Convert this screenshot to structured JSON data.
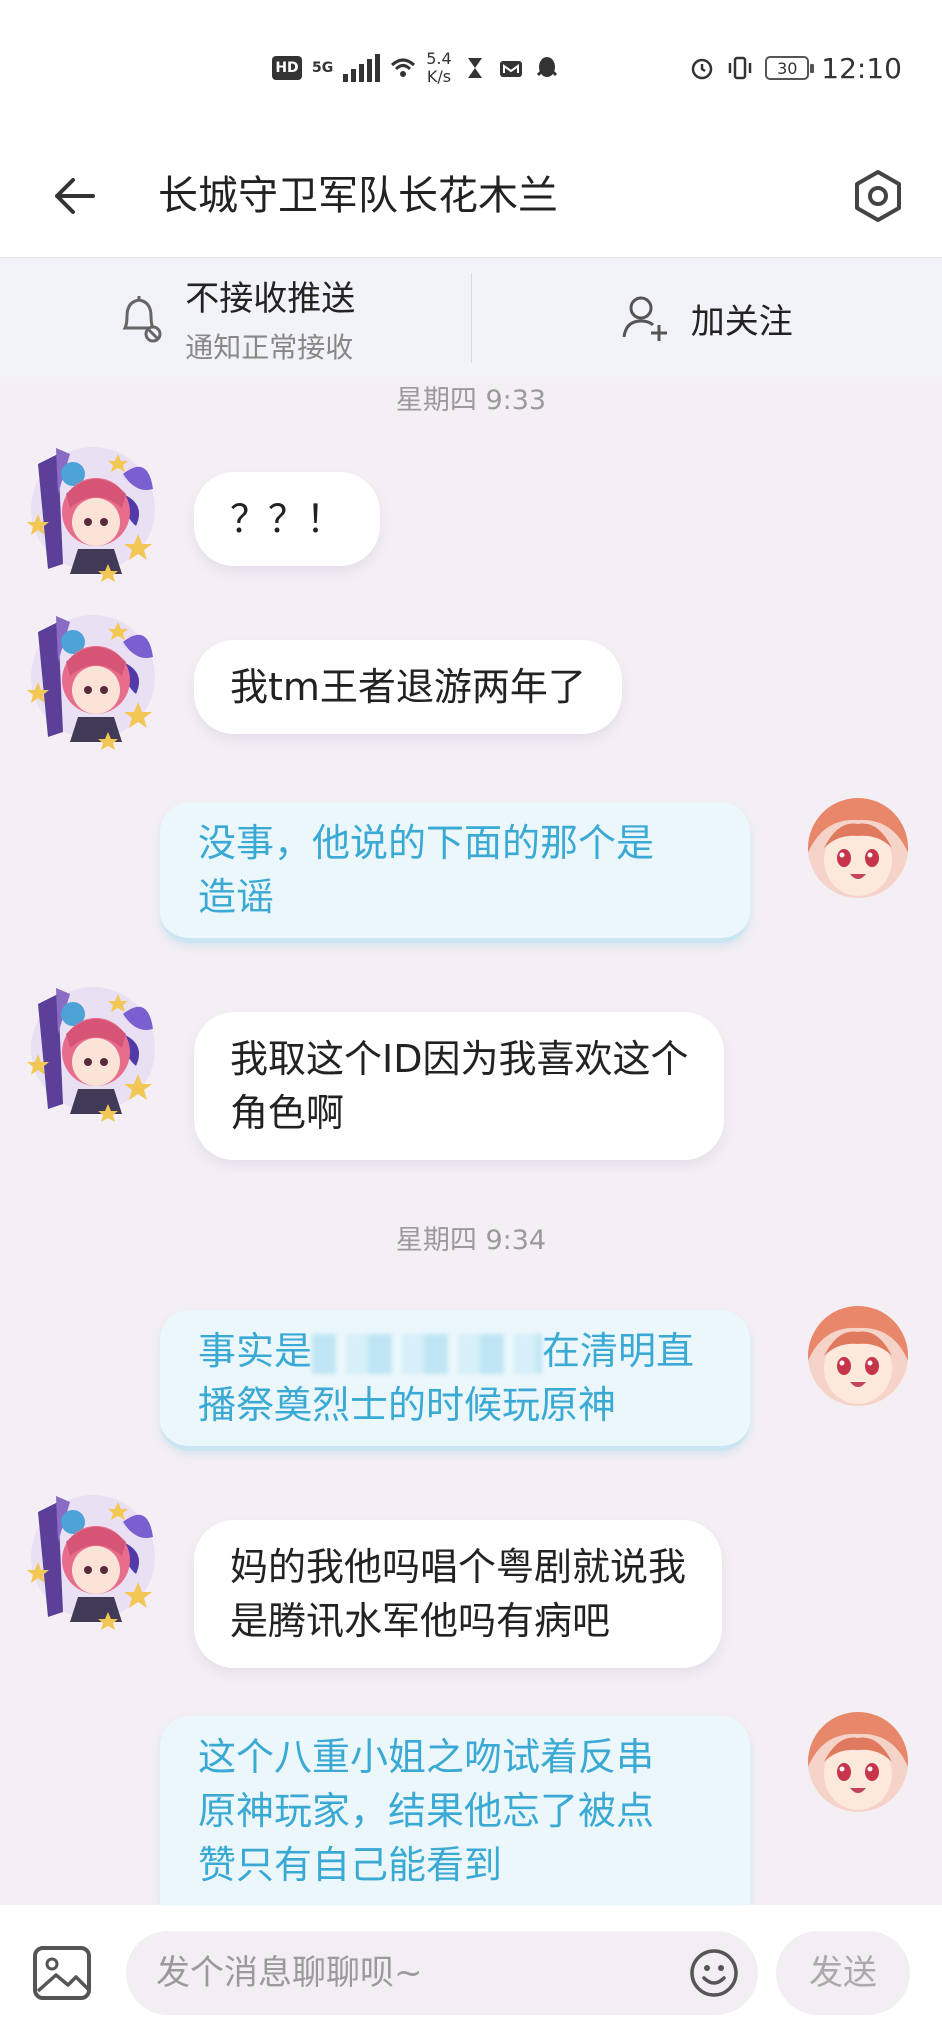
{
  "status_bar": {
    "hd": "HD",
    "network": "5G",
    "speed_value": "5.4",
    "speed_unit": "K/s",
    "battery": "30",
    "time": "12:10"
  },
  "header": {
    "title": "长城守卫军队长花木兰"
  },
  "actions": {
    "push_main": "不接收推送",
    "push_sub": "通知正常接收",
    "follow": "加关注"
  },
  "chat": {
    "timestamps": [
      "星期四 9:33",
      "星期四 9:34"
    ],
    "messages": [
      {
        "side": "in",
        "lines": [
          "？？！"
        ]
      },
      {
        "side": "in",
        "lines": [
          "我tm王者退游两年了"
        ]
      },
      {
        "side": "out",
        "lines": [
          "没事，他说的下面的那个是",
          "造谣"
        ]
      },
      {
        "side": "in",
        "lines": [
          "我取这个ID因为我喜欢这个",
          "角色啊"
        ]
      },
      {
        "side": "out",
        "lines_parts": [
          "事实是",
          "在清明直",
          "播祭奠烈士的时候玩原神"
        ]
      },
      {
        "side": "in",
        "lines": [
          "妈的我他吗唱个粤剧就说我",
          "是腾讯水军他吗有病吧"
        ]
      },
      {
        "side": "out",
        "lines": [
          "这个八重小姐之吻试着反串",
          "原神玩家，结果他忘了被点",
          "赞只有自己能看到"
        ]
      }
    ]
  },
  "input_bar": {
    "placeholder": "发个消息聊聊呗~",
    "send": "发送"
  },
  "colors": {
    "background": "#f4eff4",
    "incoming_bubble": "#ffffff",
    "outgoing_bubble": "#ecf7fc",
    "outgoing_text": "#3aa9d4"
  }
}
